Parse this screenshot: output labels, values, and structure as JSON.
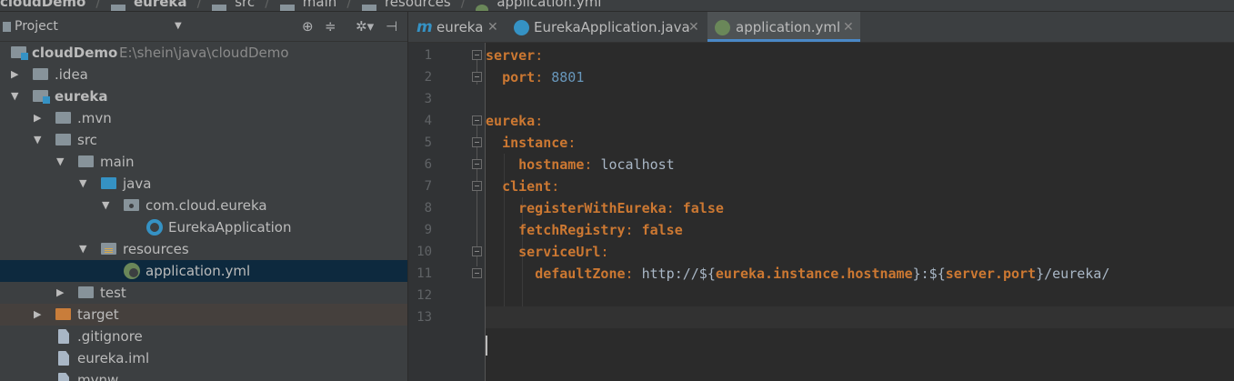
{
  "breadcrumb": [
    "cloudDemo",
    "eureka",
    "src",
    "main",
    "resources",
    "application.yml"
  ],
  "project_panel": {
    "title": "Project",
    "toolbar_icons": [
      "crosshair-icon",
      "collapse-all-icon",
      "gear-icon",
      "hide-panel-icon"
    ]
  },
  "tree": [
    {
      "label": "cloudDemo",
      "path": "E:\\shein\\java\\cloudDemo",
      "icon": "module-icon",
      "expanded": true,
      "bold": true
    },
    {
      "label": ".idea",
      "icon": "folder-icon",
      "expanded": false
    },
    {
      "label": "eureka",
      "icon": "module-icon",
      "expanded": true,
      "bold": true
    },
    {
      "label": ".mvn",
      "icon": "folder-icon",
      "expanded": false
    },
    {
      "label": "src",
      "icon": "folder-icon",
      "expanded": true
    },
    {
      "label": "main",
      "icon": "folder-icon",
      "expanded": true
    },
    {
      "label": "java",
      "icon": "source-folder-icon",
      "expanded": true
    },
    {
      "label": "com.cloud.eureka",
      "icon": "package-icon",
      "expanded": true
    },
    {
      "label": "EurekaApplication",
      "icon": "spring-boot-class-icon"
    },
    {
      "label": "resources",
      "icon": "resources-folder-icon",
      "expanded": true
    },
    {
      "label": "application.yml",
      "icon": "spring-config-icon",
      "selected": true
    },
    {
      "label": "test",
      "icon": "folder-icon",
      "expanded": false
    },
    {
      "label": "target",
      "icon": "excluded-folder-icon",
      "expanded": false
    },
    {
      "label": ".gitignore",
      "icon": "text-file-icon"
    },
    {
      "label": "eureka.iml",
      "icon": "iml-file-icon"
    },
    {
      "label": "mvnw",
      "icon": "text-file-icon"
    }
  ],
  "tabs": [
    {
      "label": "eureka",
      "icon": "maven-icon",
      "active": false
    },
    {
      "label": "EurekaApplication.java",
      "icon": "spring-boot-class-icon",
      "active": false
    },
    {
      "label": "application.yml",
      "icon": "spring-config-icon",
      "active": true
    }
  ],
  "editor": {
    "line_numbers": [
      "1",
      "2",
      "3",
      "4",
      "5",
      "6",
      "7",
      "8",
      "9",
      "10",
      "11",
      "12",
      "13"
    ],
    "lines": [
      [
        {
          "t": "server",
          "c": "k"
        },
        {
          "t": ":",
          "c": "p"
        }
      ],
      [
        {
          "t": "  "
        },
        {
          "t": "port",
          "c": "k"
        },
        {
          "t": ": ",
          "c": "p"
        },
        {
          "t": "8801",
          "c": "n"
        }
      ],
      [],
      [
        {
          "t": "eureka",
          "c": "k"
        },
        {
          "t": ":",
          "c": "p"
        }
      ],
      [
        {
          "t": "  "
        },
        {
          "t": "instance",
          "c": "k"
        },
        {
          "t": ":",
          "c": "p"
        }
      ],
      [
        {
          "t": "    "
        },
        {
          "t": "hostname",
          "c": "k"
        },
        {
          "t": ": ",
          "c": "p"
        },
        {
          "t": "localhost",
          "c": "v"
        }
      ],
      [
        {
          "t": "  "
        },
        {
          "t": "client",
          "c": "k"
        },
        {
          "t": ":",
          "c": "p"
        }
      ],
      [
        {
          "t": "    "
        },
        {
          "t": "registerWithEureka",
          "c": "k"
        },
        {
          "t": ": ",
          "c": "p"
        },
        {
          "t": "false",
          "c": "k"
        }
      ],
      [
        {
          "t": "    "
        },
        {
          "t": "fetchRegistry",
          "c": "k"
        },
        {
          "t": ": ",
          "c": "p"
        },
        {
          "t": "false",
          "c": "k"
        }
      ],
      [
        {
          "t": "    "
        },
        {
          "t": "serviceUrl",
          "c": "k"
        },
        {
          "t": ":",
          "c": "p"
        }
      ],
      [
        {
          "t": "      "
        },
        {
          "t": "defaultZone",
          "c": "k"
        },
        {
          "t": ": ",
          "c": "p"
        },
        {
          "t": "http://${",
          "c": "v"
        },
        {
          "t": "eureka.instance.hostname",
          "c": "k"
        },
        {
          "t": "}:${",
          "c": "v"
        },
        {
          "t": "server.port",
          "c": "k"
        },
        {
          "t": "}/eureka/",
          "c": "v"
        }
      ],
      [],
      []
    ]
  },
  "colors": {
    "keyword": "#cc7832",
    "number": "#6897bb",
    "value": "#a9b7c6",
    "selection": "#0d293e",
    "tab_underline": "#4a88c7"
  }
}
